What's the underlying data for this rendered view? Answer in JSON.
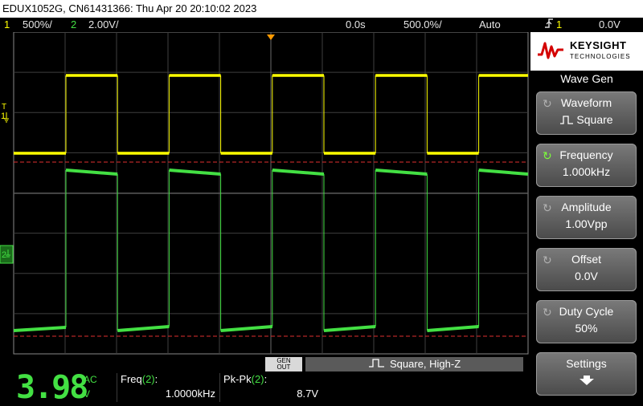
{
  "title": "EDUX1052G, CN61431366: Thu Apr 20 20:10:02 2023",
  "status": {
    "ch1_num": "1",
    "ch1_scale": "500%/",
    "ch2_num": "2",
    "ch2_scale": "2.00V/",
    "time_pos": "0.0s",
    "time_scale": "500.0%/",
    "trigger_mode": "Auto",
    "trigger_icon": "ƒ",
    "trigger_channel": "1",
    "trigger_level": "0.0V"
  },
  "markers": {
    "ch1_marker": "1",
    "ch2_marker": "2",
    "trigger_marker": "T"
  },
  "waveform_colors": {
    "ch1": "#ffff00",
    "ch2": "#43e043",
    "cursor": "#e03030"
  },
  "gen_out": {
    "line1": "GEN",
    "line2": "OUT"
  },
  "gen_status": "Square, High-Z",
  "measurement": {
    "big_value": "3.98",
    "coupling": "AC",
    "unit": "V",
    "freq_label": "Freq",
    "freq_channel": "(2)",
    "freq_colon": ":",
    "freq_value": "1.0000kHz",
    "pkpk_label": "Pk-Pk",
    "pkpk_channel": "(2)",
    "pkpk_colon": ":",
    "pkpk_value": "8.7V"
  },
  "logo": {
    "name": "KEYSIGHT",
    "sub": "TECHNOLOGIES"
  },
  "panel": {
    "title": "Wave Gen",
    "softkeys": [
      {
        "label": "Waveform",
        "value": "Square",
        "icon": "knob-icon"
      },
      {
        "label": "Frequency",
        "value": "1.000kHz",
        "icon": "knob-icon"
      },
      {
        "label": "Amplitude",
        "value": "1.00Vpp",
        "icon": "knob-icon"
      },
      {
        "label": "Offset",
        "value": "0.0V",
        "icon": "knob-icon"
      },
      {
        "label": "Duty Cycle",
        "value": "50%",
        "icon": "knob-icon"
      },
      {
        "label": "Settings",
        "value": "",
        "icon": "arrow-down-icon"
      }
    ]
  }
}
